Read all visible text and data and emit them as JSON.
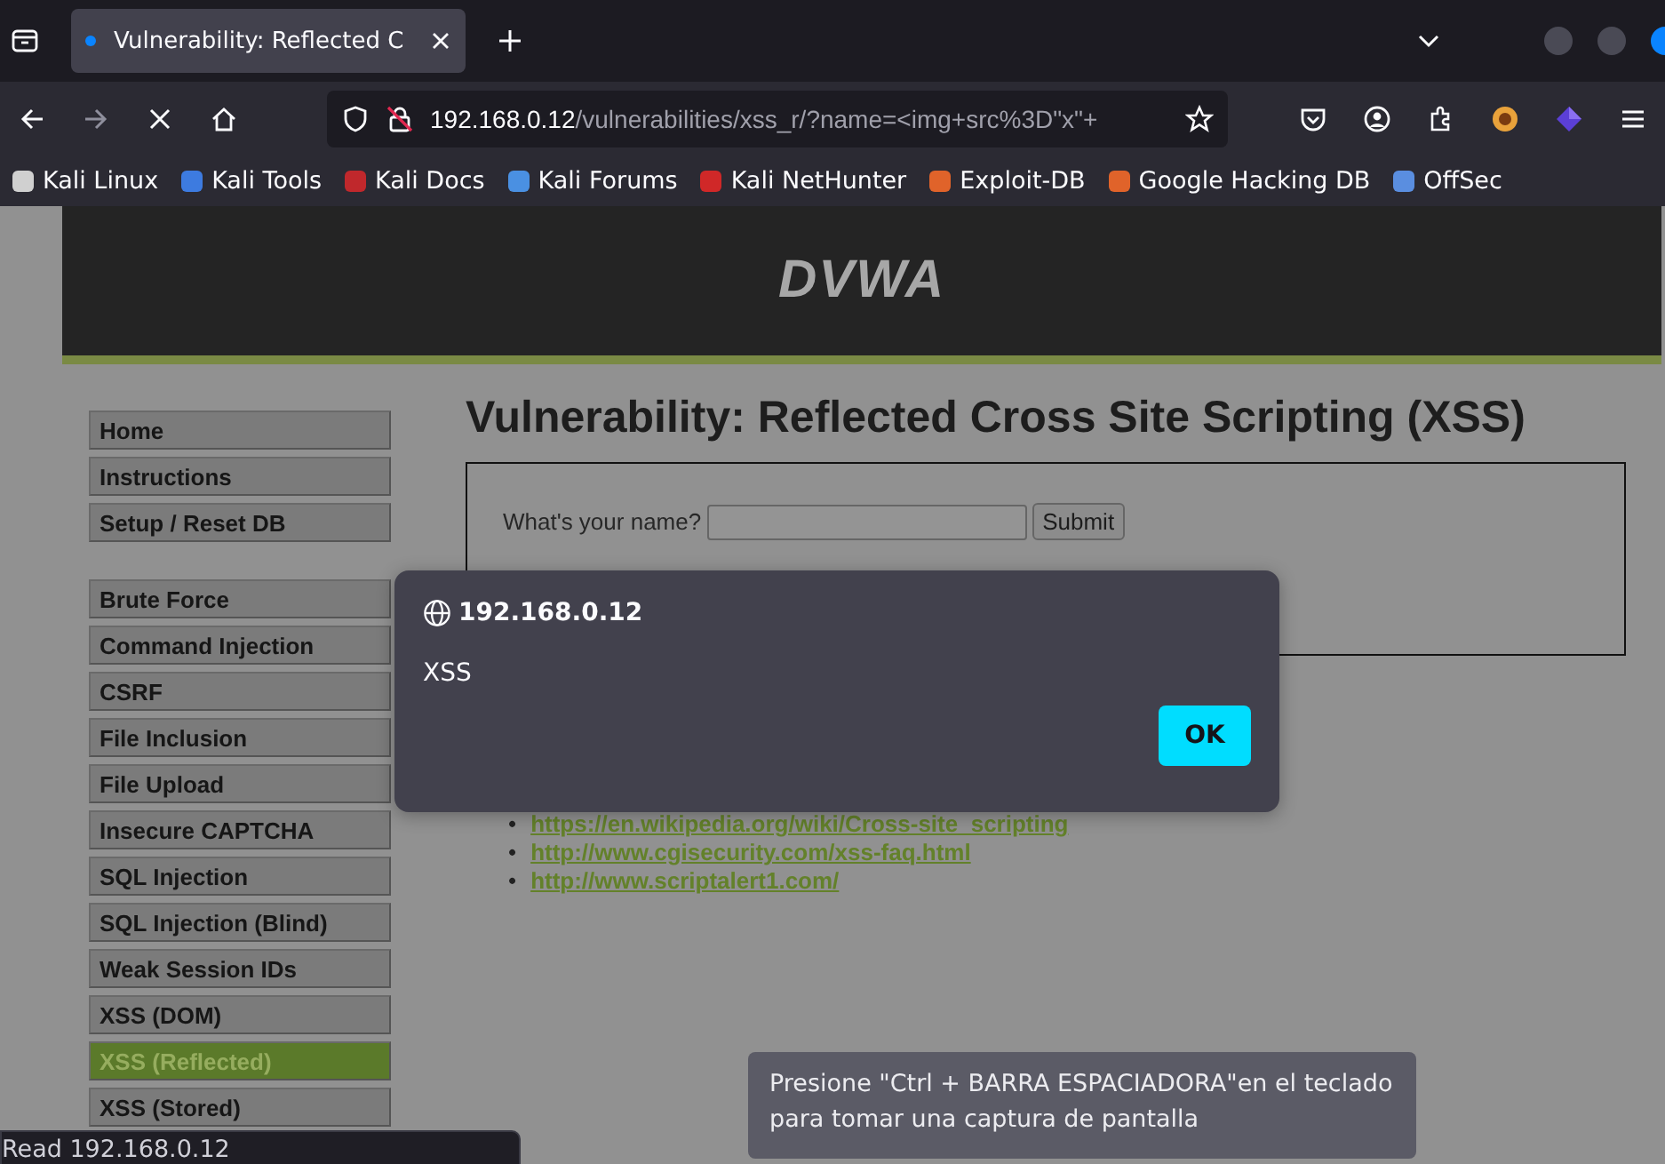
{
  "browser": {
    "tab": {
      "title": "Vulnerability: Reflected C",
      "loading": true
    },
    "url": {
      "host": "192.168.0.12",
      "path": "/vulnerabilities/xss_r/?name=<img+src%3D\"x\"+"
    },
    "bookmarks": [
      {
        "label": "Kali Linux",
        "color": "#d0d0d0"
      },
      {
        "label": "Kali Tools",
        "color": "#3d7be0"
      },
      {
        "label": "Kali Docs",
        "color": "#c0282c"
      },
      {
        "label": "Kali Forums",
        "color": "#4a90e2"
      },
      {
        "label": "Kali NetHunter",
        "color": "#d02828"
      },
      {
        "label": "Exploit-DB",
        "color": "#e0632a"
      },
      {
        "label": "Google Hacking DB",
        "color": "#e0632a"
      },
      {
        "label": "OffSec",
        "color": "#5a8ee0"
      }
    ]
  },
  "page": {
    "logo": "DVWA",
    "menu_groups": [
      [
        {
          "label": "Home",
          "selected": false
        },
        {
          "label": "Instructions",
          "selected": false
        },
        {
          "label": "Setup / Reset DB",
          "selected": false
        }
      ],
      [
        {
          "label": "Brute Force",
          "selected": false
        },
        {
          "label": "Command Injection",
          "selected": false
        },
        {
          "label": "CSRF",
          "selected": false
        },
        {
          "label": "File Inclusion",
          "selected": false
        },
        {
          "label": "File Upload",
          "selected": false
        },
        {
          "label": "Insecure CAPTCHA",
          "selected": false
        },
        {
          "label": "SQL Injection",
          "selected": false
        },
        {
          "label": "SQL Injection (Blind)",
          "selected": false
        },
        {
          "label": "Weak Session IDs",
          "selected": false
        },
        {
          "label": "XSS (DOM)",
          "selected": false
        },
        {
          "label": "XSS (Reflected)",
          "selected": true
        },
        {
          "label": "XSS (Stored)",
          "selected": false
        }
      ]
    ],
    "heading": "Vulnerability: Reflected Cross Site Scripting (XSS)",
    "form": {
      "label": "What's your name?",
      "button": "Submit"
    },
    "links": [
      {
        "marker": "•",
        "url": "https://en.wikipedia.org/wiki/Cross-site_scripting"
      },
      {
        "marker": "•",
        "url": "http://www.cgisecurity.com/xss-faq.html"
      },
      {
        "marker": "•",
        "url": "http://www.scriptalert1.com/"
      }
    ]
  },
  "dialog": {
    "origin": "192.168.0.12",
    "message": "XSS",
    "button": "OK"
  },
  "tooltip": [
    "Presione \"Ctrl + BARRA ESPACIADORA\"en el teclado",
    "para tomar una captura de pantalla"
  ],
  "status_bar": "Read 192.168.0.12"
}
